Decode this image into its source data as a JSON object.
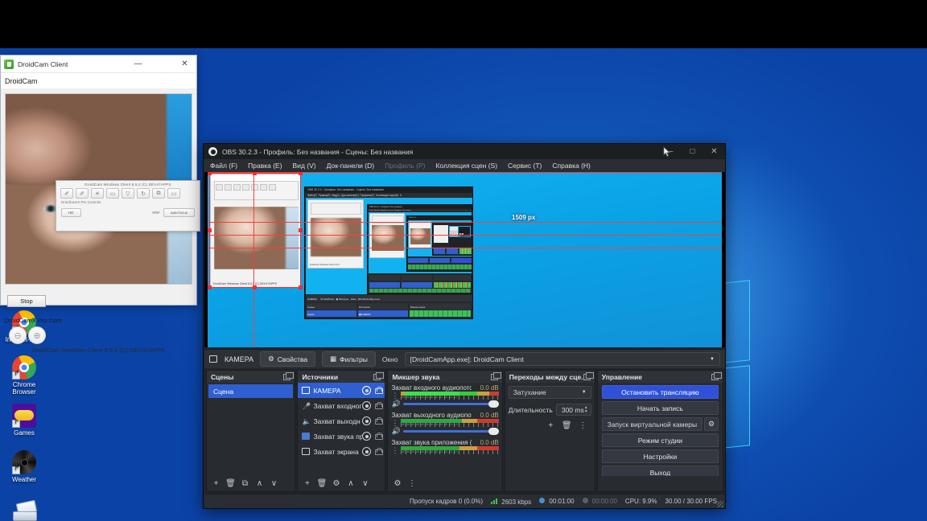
{
  "desktop": {
    "icons": [
      {
        "label": "Internet-Start",
        "icon": "chrome-icon"
      },
      {
        "label": "Chrome Browser",
        "icon": "chrome-icon"
      },
      {
        "label": "Games",
        "icon": "gamepad-icon"
      },
      {
        "label": "Weather",
        "icon": "weather-icon"
      },
      {
        "label": "",
        "icon": "scanner-icon"
      }
    ]
  },
  "droidcam": {
    "title": "DroidCam Client",
    "minimize": "—",
    "maximize": "",
    "close": "✕",
    "menu": "DroidCam",
    "stop_button": "Stop",
    "pro_label": "DroidCamX Pro Cont",
    "zoom_out_icon": "zoom-out-icon",
    "zoom_in_icon": "zoom-in-icon",
    "footer": "DroidCam Windows Client 6.5.2 (C) DEV47APPS",
    "overlay": {
      "caption": "DroidCam Windows Client 6.5.2 (C) DEV47APPS",
      "tools": [
        "✐",
        "✐",
        "☀",
        "▭",
        "▽",
        "↻",
        "⧉",
        "▭"
      ],
      "sub_label": "DroidCamX Pro Controls",
      "left_button": "HD",
      "radio_label": "IR/IF",
      "right_button": "auto-focus"
    }
  },
  "obs": {
    "title": "OBS 30.2.3 - Профиль: Без названия - Сцены: Без названия",
    "win_minimize": "–",
    "win_maximize": "□",
    "win_close": "✕",
    "menu": [
      {
        "label": "Файл (F)",
        "dim": false
      },
      {
        "label": "Правка (E)",
        "dim": false
      },
      {
        "label": "Вид (V)",
        "dim": false
      },
      {
        "label": "Док-панели (D)",
        "dim": false
      },
      {
        "label": "Профиль (P)",
        "dim": true
      },
      {
        "label": "Коллекция сцен (S)",
        "dim": false
      },
      {
        "label": "Сервис (T)",
        "dim": false
      },
      {
        "label": "Справка (H)",
        "dim": false
      }
    ],
    "preview": {
      "size_badge": "1509 px",
      "size_badge_small": "1509 px"
    },
    "source_toolbar": {
      "source_name": "КАМЕРА",
      "properties": "Свойства",
      "filters": "Фильтры",
      "window_label": "Окно",
      "window_value": "[DroidCamApp.exe]: DroidCam Client"
    },
    "scenes": {
      "title": "Сцены",
      "items": [
        {
          "label": "Сцена",
          "selected": true
        }
      ],
      "footer_buttons": [
        "+",
        "🗑",
        "⧉",
        "∧",
        "∨"
      ]
    },
    "sources": {
      "title": "Источники",
      "items": [
        {
          "label": "КАМЕРА",
          "icon": "window-capture-icon",
          "selected": true,
          "locked": false
        },
        {
          "label": "Захват входног",
          "icon": "microphone-icon",
          "selected": false,
          "locked": false
        },
        {
          "label": "Захват выходн",
          "icon": "speaker-icon",
          "selected": false,
          "locked": false
        },
        {
          "label": "Захват звука пр",
          "icon": "app-audio-icon",
          "selected": false,
          "locked": false
        },
        {
          "label": "Захват экрана",
          "icon": "display-capture-icon",
          "selected": false,
          "locked": false
        }
      ],
      "footer_buttons": [
        "+",
        "🗑",
        "⚙",
        "∧",
        "∨"
      ]
    },
    "mixer": {
      "title": "Микшер звука",
      "tracks": [
        {
          "name": "Захват входного аудиопото",
          "db": "0.0 dB",
          "has_slider": true
        },
        {
          "name": "Захват выходного аудиопот",
          "db": "0.0 dB",
          "has_slider": true
        },
        {
          "name": "Захват звука приложения (Б",
          "db": "0.0 dB",
          "has_slider": false
        }
      ],
      "scale_labels": "-60 -55 -50 -45 -40 -35 -30 -25 -20 -15 -10 -5 0"
    },
    "transitions": {
      "title": "Переходы между сце...",
      "selected": "Затухание",
      "duration_label": "Длительность",
      "duration_value": "300 ms",
      "buttons": [
        "+",
        "🗑",
        "⋮"
      ]
    },
    "controls": {
      "title": "Управление",
      "stop_stream": "Остановить трансляцию",
      "start_record": "Начать запись",
      "virtual_camera": "Запуск виртуальной камеры",
      "virtual_camera_gear": "⚙",
      "studio_mode": "Режим студии",
      "settings": "Настройки",
      "exit": "Выход"
    },
    "status": {
      "dropped_frames": "Пропуск кадров 0 (0.0%)",
      "bitrate": "2603 kbps",
      "stream_time": "00:01:00",
      "record_time": "00:00:00",
      "cpu": "CPU: 9.9%",
      "fps": "30.00 / 30.00 FPS"
    }
  },
  "colors": {
    "accent_blue": "#3050d8",
    "selection_red": "#ff2b2b",
    "desktop_blue": "#1272cc",
    "panel_bg": "#282b2f"
  }
}
